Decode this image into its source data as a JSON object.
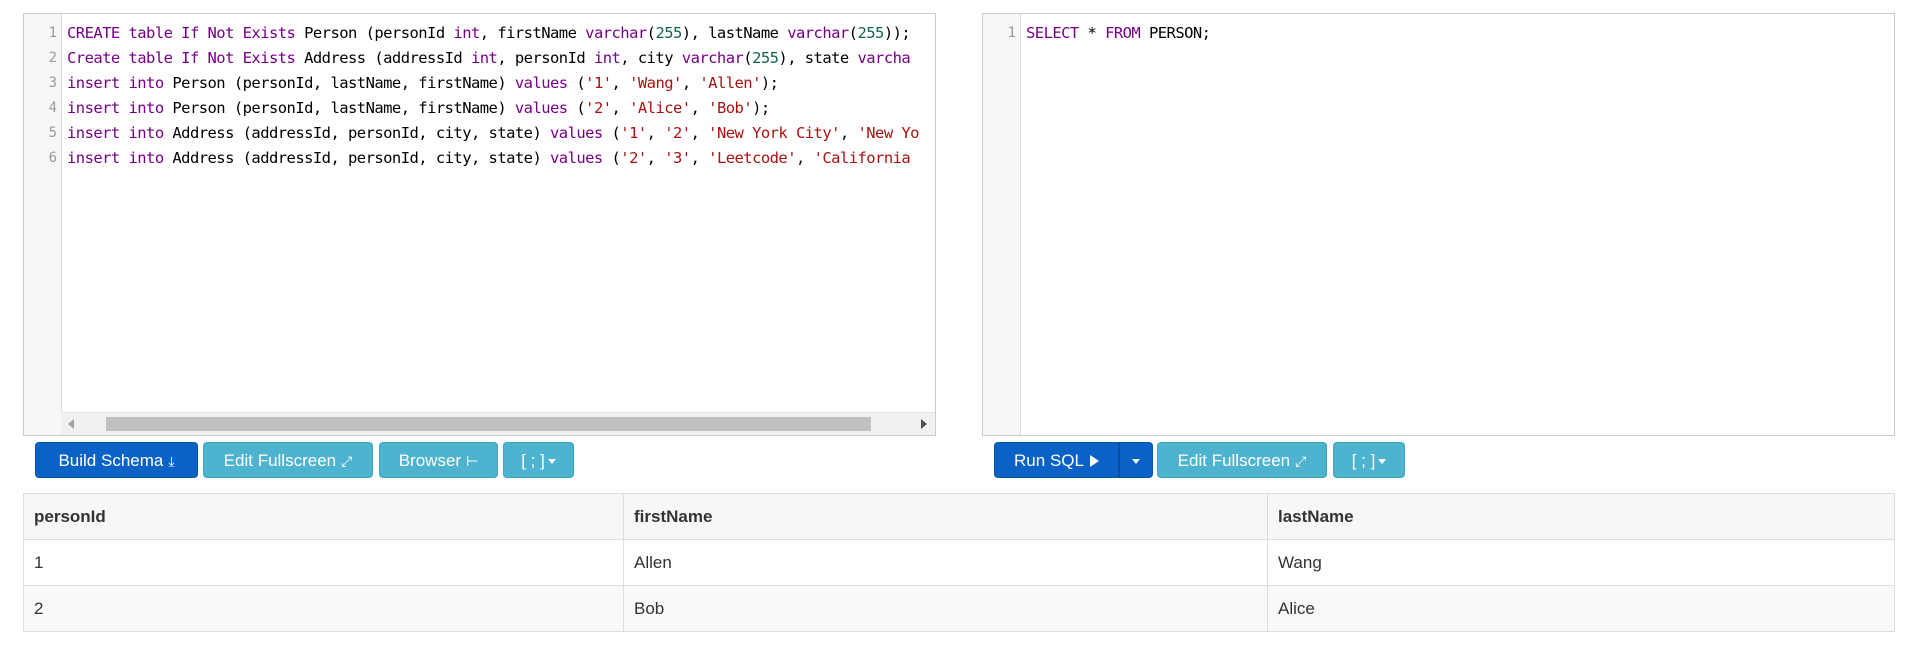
{
  "schema_editor": {
    "lines": [
      {
        "num": "1",
        "tokens": [
          {
            "t": "CREATE table If Not Exists",
            "c": "kw"
          },
          {
            "t": " Person (personId ",
            "c": ""
          },
          {
            "t": "int",
            "c": "kw"
          },
          {
            "t": ", firstName ",
            "c": ""
          },
          {
            "t": "varchar",
            "c": "kw"
          },
          {
            "t": "(",
            "c": ""
          },
          {
            "t": "255",
            "c": "num"
          },
          {
            "t": "), lastName ",
            "c": ""
          },
          {
            "t": "varchar",
            "c": "kw"
          },
          {
            "t": "(",
            "c": ""
          },
          {
            "t": "255",
            "c": "num"
          },
          {
            "t": "));",
            "c": ""
          }
        ]
      },
      {
        "num": "2",
        "tokens": [
          {
            "t": "Create table If Not Exists",
            "c": "kw"
          },
          {
            "t": " Address (addressId ",
            "c": ""
          },
          {
            "t": "int",
            "c": "kw"
          },
          {
            "t": ", personId ",
            "c": ""
          },
          {
            "t": "int",
            "c": "kw"
          },
          {
            "t": ", city ",
            "c": ""
          },
          {
            "t": "varchar",
            "c": "kw"
          },
          {
            "t": "(",
            "c": ""
          },
          {
            "t": "255",
            "c": "num"
          },
          {
            "t": "), state ",
            "c": ""
          },
          {
            "t": "varcha",
            "c": "kw"
          }
        ]
      },
      {
        "num": "3",
        "tokens": [
          {
            "t": "insert into",
            "c": "kw"
          },
          {
            "t": " Person (personId, lastName, firstName) ",
            "c": ""
          },
          {
            "t": "values",
            "c": "kw"
          },
          {
            "t": " (",
            "c": ""
          },
          {
            "t": "'1'",
            "c": "str"
          },
          {
            "t": ", ",
            "c": ""
          },
          {
            "t": "'Wang'",
            "c": "str"
          },
          {
            "t": ", ",
            "c": ""
          },
          {
            "t": "'Allen'",
            "c": "str"
          },
          {
            "t": ");",
            "c": ""
          }
        ]
      },
      {
        "num": "4",
        "tokens": [
          {
            "t": "insert into",
            "c": "kw"
          },
          {
            "t": " Person (personId, lastName, firstName) ",
            "c": ""
          },
          {
            "t": "values",
            "c": "kw"
          },
          {
            "t": " (",
            "c": ""
          },
          {
            "t": "'2'",
            "c": "str"
          },
          {
            "t": ", ",
            "c": ""
          },
          {
            "t": "'Alice'",
            "c": "str"
          },
          {
            "t": ", ",
            "c": ""
          },
          {
            "t": "'Bob'",
            "c": "str"
          },
          {
            "t": ");",
            "c": ""
          }
        ]
      },
      {
        "num": "5",
        "tokens": [
          {
            "t": "insert into",
            "c": "kw"
          },
          {
            "t": " Address (addressId, personId, city, state) ",
            "c": ""
          },
          {
            "t": "values",
            "c": "kw"
          },
          {
            "t": " (",
            "c": ""
          },
          {
            "t": "'1'",
            "c": "str"
          },
          {
            "t": ", ",
            "c": ""
          },
          {
            "t": "'2'",
            "c": "str"
          },
          {
            "t": ", ",
            "c": ""
          },
          {
            "t": "'New York City'",
            "c": "str"
          },
          {
            "t": ", ",
            "c": ""
          },
          {
            "t": "'New Yo",
            "c": "str"
          }
        ]
      },
      {
        "num": "6",
        "tokens": [
          {
            "t": "insert into",
            "c": "kw"
          },
          {
            "t": " Address (addressId, personId, city, state) ",
            "c": ""
          },
          {
            "t": "values",
            "c": "kw"
          },
          {
            "t": " (",
            "c": ""
          },
          {
            "t": "'2'",
            "c": "str"
          },
          {
            "t": ", ",
            "c": ""
          },
          {
            "t": "'3'",
            "c": "str"
          },
          {
            "t": ", ",
            "c": ""
          },
          {
            "t": "'Leetcode'",
            "c": "str"
          },
          {
            "t": ", ",
            "c": ""
          },
          {
            "t": "'California",
            "c": "str"
          }
        ]
      }
    ]
  },
  "query_editor": {
    "lines": [
      {
        "num": "1",
        "tokens": [
          {
            "t": "SELECT",
            "c": "kw"
          },
          {
            "t": " * ",
            "c": ""
          },
          {
            "t": "FROM",
            "c": "kw"
          },
          {
            "t": " PERSON;",
            "c": ""
          }
        ]
      }
    ]
  },
  "schema_toolbar": {
    "build_schema": "Build Schema",
    "edit_fullscreen": "Edit Fullscreen",
    "browser": "Browser",
    "delimiter": "[ ; ]"
  },
  "query_toolbar": {
    "run_sql": "Run SQL",
    "edit_fullscreen": "Edit Fullscreen",
    "delimiter": "[ ; ]"
  },
  "results": {
    "columns": [
      "personId",
      "firstName",
      "lastName"
    ],
    "rows": [
      [
        "1",
        "Allen",
        "Wang"
      ],
      [
        "2",
        "Bob",
        "Alice"
      ]
    ]
  },
  "colors": {
    "primary": "#0a61c6",
    "info": "#4db3ce",
    "keyword": "#770088",
    "string": "#aa1111",
    "number": "#116644"
  }
}
